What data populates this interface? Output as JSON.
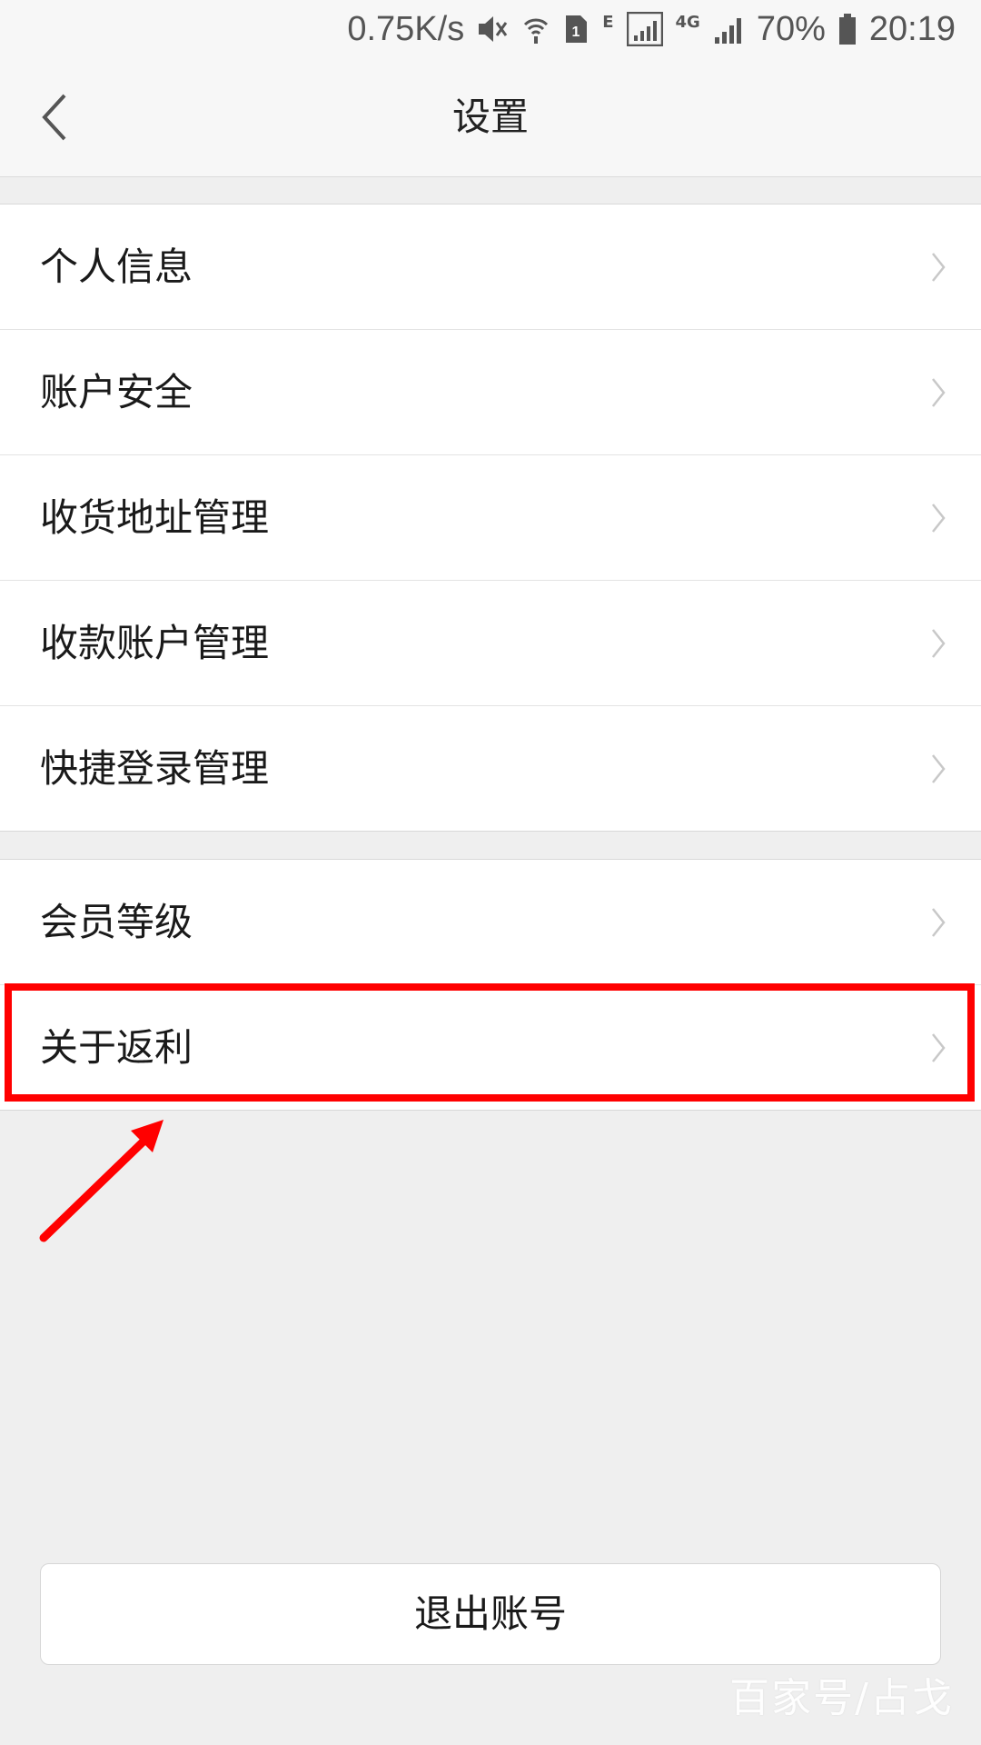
{
  "status_bar": {
    "speed": "0.75K/s",
    "network_small": "E",
    "network_4g": "4G",
    "battery": "70%",
    "time": "20:19",
    "sim": "1",
    "icons": [
      "mute-icon",
      "wifi-icon",
      "sim-icon",
      "signal-icon",
      "signal-icon",
      "battery-icon"
    ]
  },
  "header": {
    "title": "设置",
    "back_icon": "chevron-left-icon"
  },
  "groups": [
    {
      "items": [
        {
          "label": "个人信息"
        },
        {
          "label": "账户安全"
        },
        {
          "label": "收货地址管理"
        },
        {
          "label": "收款账户管理"
        },
        {
          "label": "快捷登录管理"
        }
      ]
    },
    {
      "items": [
        {
          "label": "会员等级"
        },
        {
          "label": "关于返利"
        }
      ]
    }
  ],
  "logout_label": "退出账号",
  "watermark": "百家号/占戈",
  "colors": {
    "highlight": "#ff0000",
    "background": "#efefef",
    "card": "#ffffff"
  }
}
